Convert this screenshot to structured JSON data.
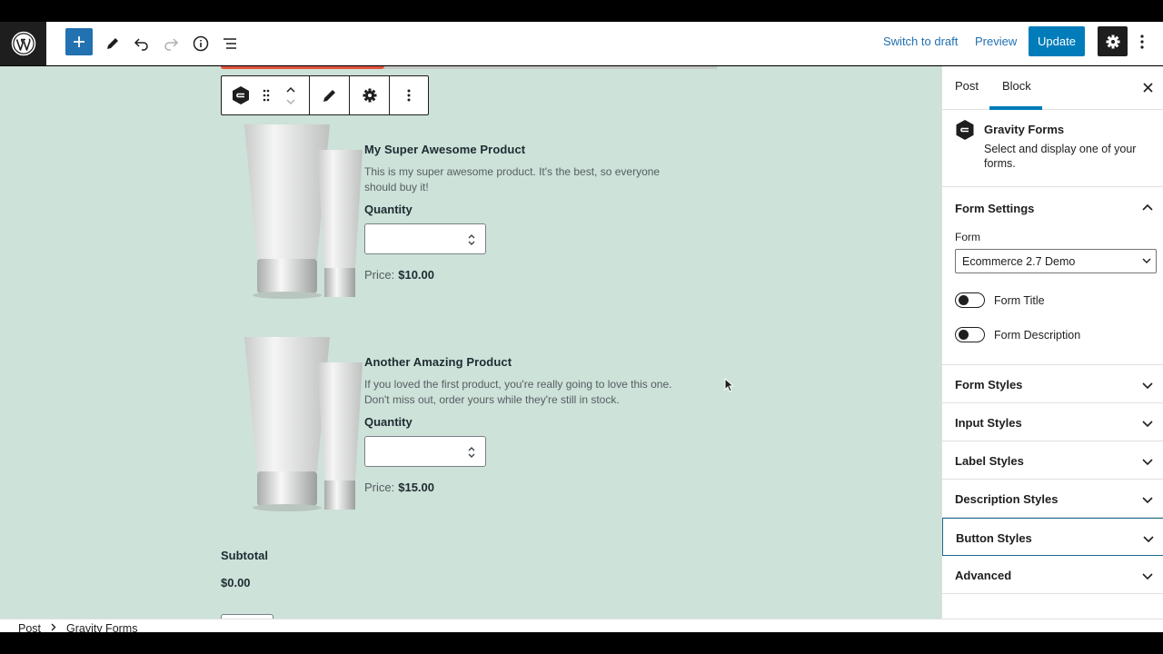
{
  "toolbar": {
    "switch_draft": "Switch to draft",
    "preview": "Preview",
    "update": "Update"
  },
  "canvas": {
    "progress_fraction": 0.33,
    "products": [
      {
        "name": "My Super Awesome Product",
        "description": "This is my super awesome product. It's the best, so everyone should buy it!",
        "quantity_label": "Quantity",
        "quantity_value": "",
        "price_label": "Price:",
        "price_value": "$10.00"
      },
      {
        "name": "Another Amazing Product",
        "description": "If you loved the first product, you're really going to love this one. Don't miss out, order yours while they're still in stock.",
        "quantity_label": "Quantity",
        "quantity_value": "",
        "price_label": "Price:",
        "price_value": "$15.00"
      }
    ],
    "subtotal_label": "Subtotal",
    "subtotal_value": "$0.00"
  },
  "sidebar": {
    "tabs": [
      {
        "label": "Post",
        "active": false
      },
      {
        "label": "Block",
        "active": true
      }
    ],
    "block": {
      "title": "Gravity Forms",
      "description": "Select and display one of your forms."
    },
    "form_settings": {
      "heading": "Form Settings",
      "form_label": "Form",
      "form_value": "Ecommerce 2.7 Demo",
      "toggles": [
        {
          "label": "Form Title",
          "checked": false
        },
        {
          "label": "Form Description",
          "checked": false
        }
      ]
    },
    "panels": [
      {
        "label": "Form Styles"
      },
      {
        "label": "Input Styles"
      },
      {
        "label": "Label Styles"
      },
      {
        "label": "Description Styles"
      },
      {
        "label": "Button Styles",
        "focused": true
      },
      {
        "label": "Advanced"
      }
    ]
  },
  "breadcrumb": [
    "Post",
    "Gravity Forms"
  ],
  "colors": {
    "accent": "#007cba",
    "canvas_bg": "#cde2d8",
    "progress": "#e2513b"
  }
}
